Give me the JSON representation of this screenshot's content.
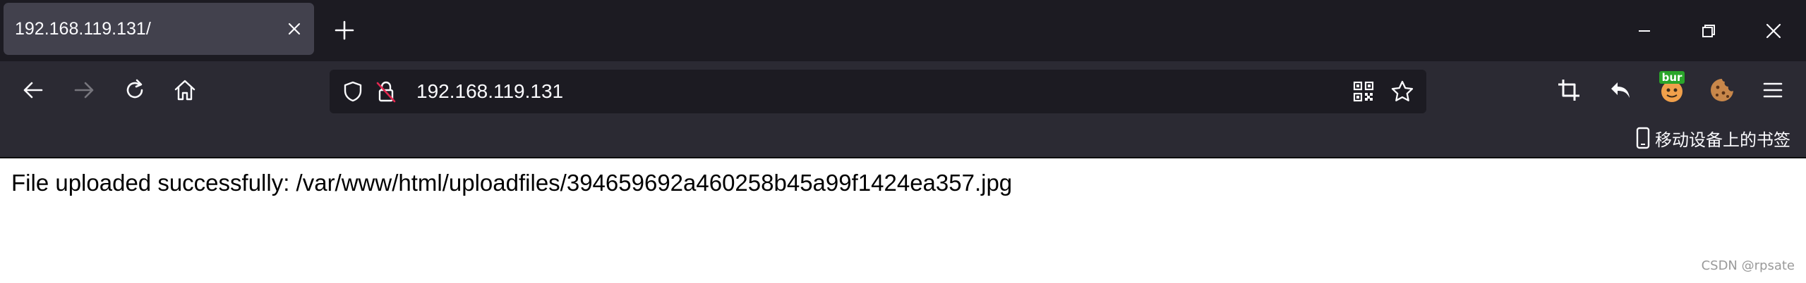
{
  "tab": {
    "title": "192.168.119.131/"
  },
  "addressbar": {
    "url": "192.168.119.131"
  },
  "toolbar": {
    "extension_badge": "bur"
  },
  "bookmarks": {
    "mobile_label": "移动设备上的书签"
  },
  "page": {
    "message": "File uploaded successfully: /var/www/html/uploadfiles/394659692a460258b45a99f1424ea357.jpg"
  },
  "watermark": {
    "text": "CSDN @rpsate"
  },
  "icons": {
    "close_tab": "close-icon",
    "new_tab": "plus-icon",
    "minimize": "minimize-icon",
    "restore": "restore-icon",
    "close_window": "close-icon",
    "back": "arrow-left-icon",
    "forward": "arrow-right-icon",
    "reload": "reload-icon",
    "home": "home-icon",
    "tracking": "shield-icon",
    "insecure": "insecure-lock-icon",
    "qr": "qr-code-icon",
    "bookmark": "star-icon",
    "crop": "crop-icon",
    "undo": "undo-icon",
    "burp": "burp-extension-icon",
    "cookie": "cookie-icon",
    "menu": "hamburger-menu-icon",
    "mobile": "mobile-device-icon"
  },
  "colors": {
    "tab_bar": "#1c1b22",
    "toolbar": "#2b2a33",
    "active_tab": "#42414d",
    "urlbar": "#1c1b22",
    "text_light": "#fbfbfe",
    "burp_green": "#2aa52a"
  }
}
